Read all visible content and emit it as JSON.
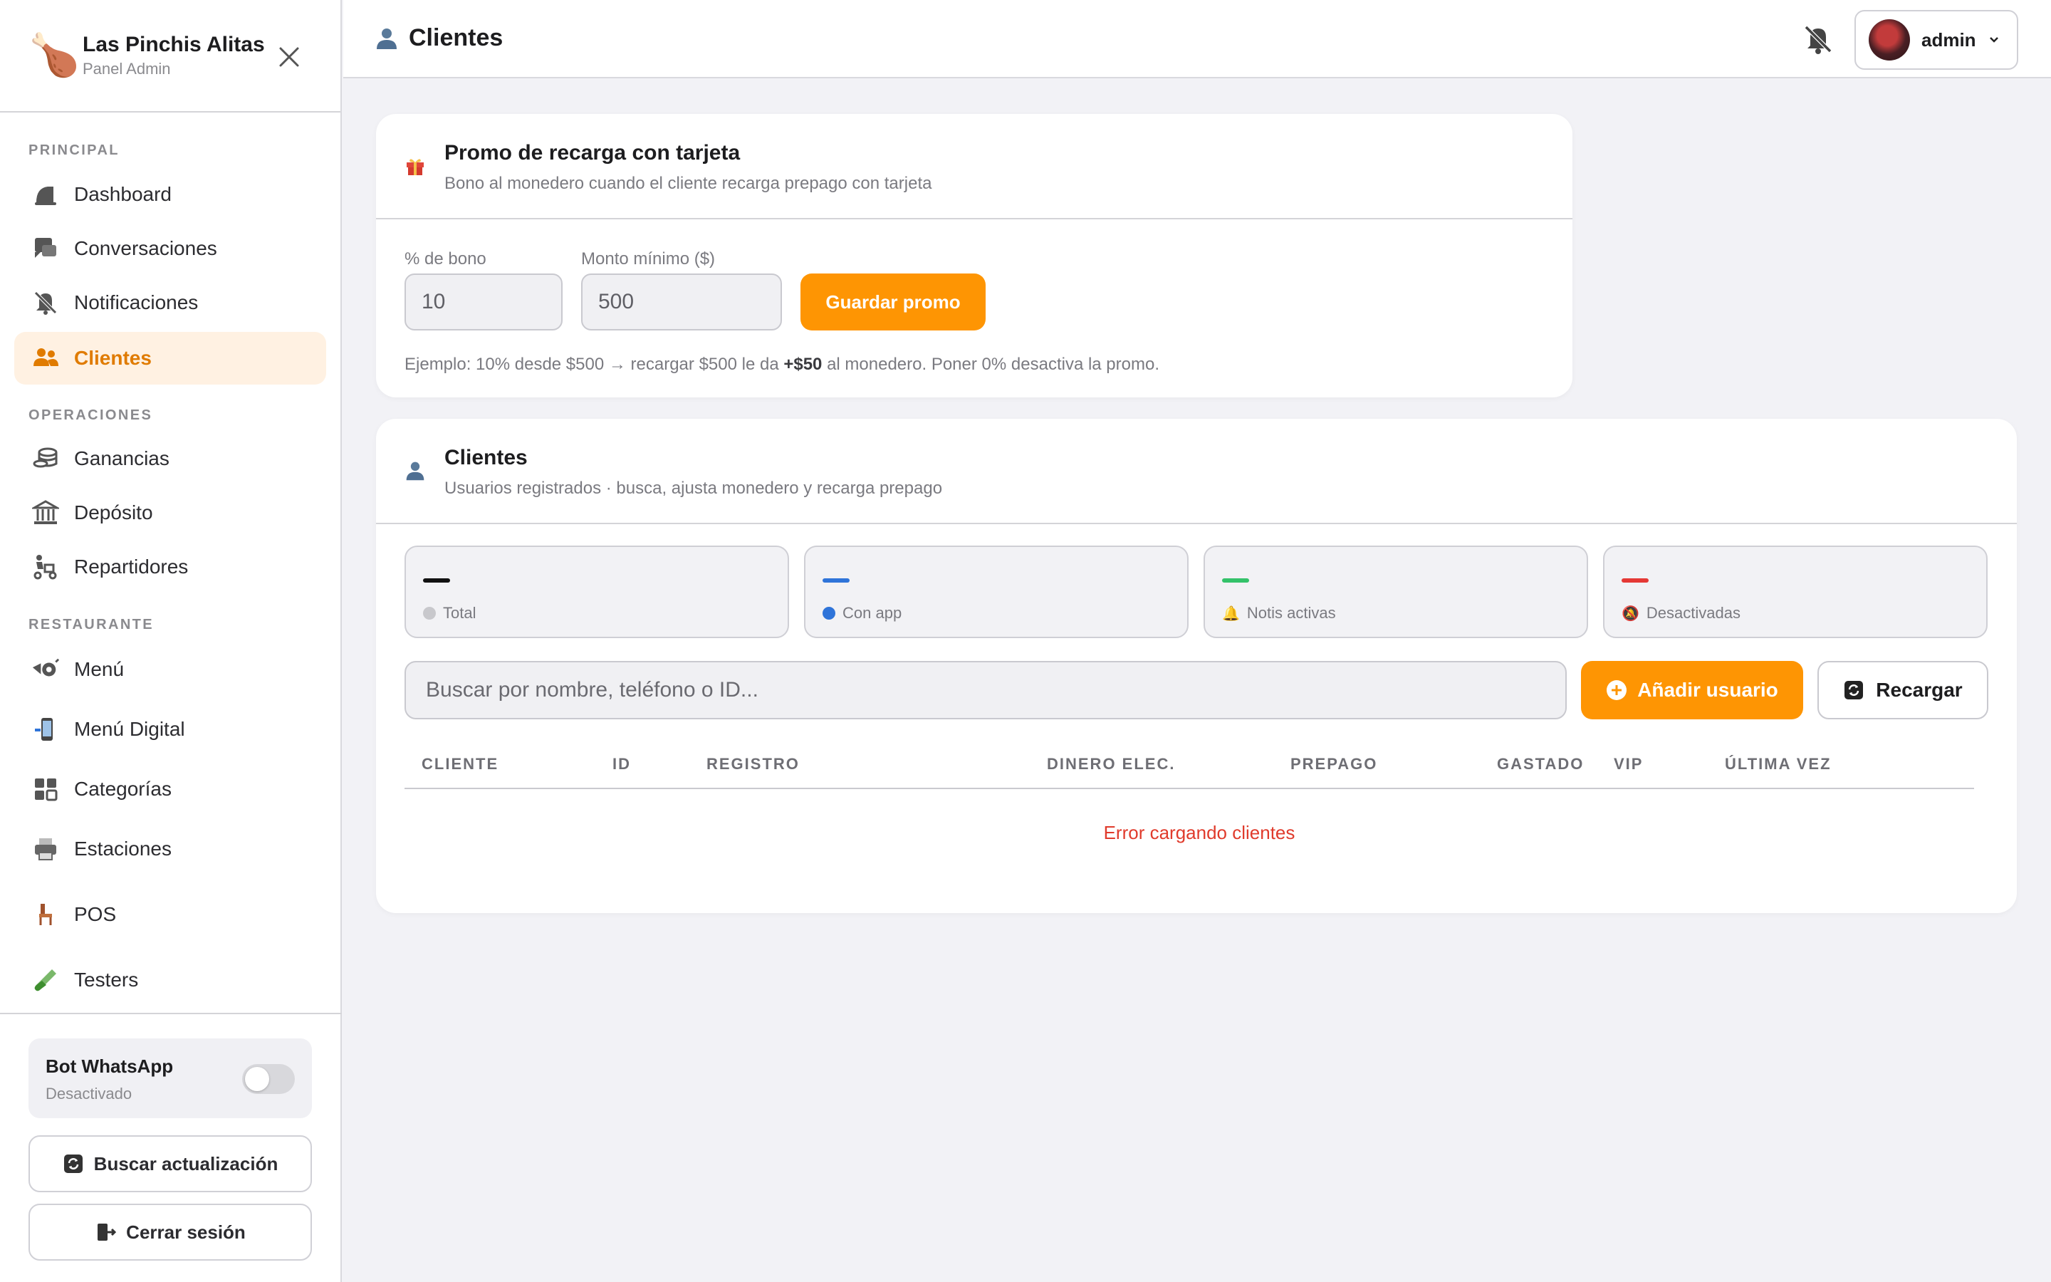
{
  "brand": {
    "emoji": "🍗",
    "title": "Las Pinchis Alitas",
    "subtitle": "Panel Admin"
  },
  "sidebar": {
    "sections": [
      "PRINCIPAL",
      "OPERACIONES",
      "RESTAURANTE"
    ],
    "items": [
      {
        "label": "Dashboard",
        "icon": "dashboard-icon"
      },
      {
        "label": "Conversaciones",
        "icon": "chat-icon"
      },
      {
        "label": "Notificaciones",
        "icon": "bell-off-icon"
      },
      {
        "label": "Clientes",
        "icon": "users-icon",
        "active": true
      },
      {
        "label": "Ganancias",
        "icon": "coins-icon"
      },
      {
        "label": "Depósito",
        "icon": "bank-icon"
      },
      {
        "label": "Repartidores",
        "icon": "delivery-icon"
      },
      {
        "label": "Menú",
        "icon": "menu-icon"
      },
      {
        "label": "Menú Digital",
        "icon": "phone-icon"
      },
      {
        "label": "Categorías",
        "icon": "grid-icon"
      },
      {
        "label": "Estaciones",
        "icon": "printer-icon"
      },
      {
        "label": "POS",
        "icon": "chair-icon"
      },
      {
        "label": "Testers",
        "icon": "test-tube-icon"
      }
    ],
    "bot": {
      "title": "Bot WhatsApp",
      "status": "Desactivado",
      "enabled": false
    },
    "update_label": "Buscar actualización",
    "logout_label": "Cerrar sesión"
  },
  "header": {
    "title": "Clientes",
    "user": "admin"
  },
  "promo": {
    "title": "Promo de recarga con tarjeta",
    "subtitle": "Bono al monedero cuando el cliente recarga prepago con tarjeta",
    "bonus_label": "% de bono",
    "bonus_value": "10",
    "min_label": "Monto mínimo ($)",
    "min_value": "500",
    "save_label": "Guardar promo",
    "hint_before": "Ejemplo: 10% desde $500 → recargar $500 le da ",
    "hint_bold": "+$50",
    "hint_after": " al monedero. Poner 0% desactiva la promo."
  },
  "clients": {
    "title": "Clientes",
    "subtitle": "Usuarios registrados · busca, ajusta monedero y recarga prepago",
    "stats": [
      {
        "label": "Total",
        "value": "—",
        "color": "#111111"
      },
      {
        "label": "Con app",
        "value": "—",
        "color": "#2f74d9"
      },
      {
        "label": "Notis activas",
        "value": "—",
        "color": "#34c26a"
      },
      {
        "label": "Desactivadas",
        "value": "—",
        "color": "#e53935"
      }
    ],
    "search_placeholder": "Buscar por nombre, teléfono o ID...",
    "add_label": "Añadir usuario",
    "reload_label": "Recargar",
    "columns": [
      "CLIENTE",
      "ID",
      "REGISTRO",
      "DINERO ELEC.",
      "PREPAGO",
      "GASTADO",
      "VIP",
      "ÚLTIMA VEZ"
    ],
    "error": "Error cargando clientes"
  },
  "colors": {
    "accent": "#fe9503",
    "active_bg": "#fff1e2",
    "active_text": "#e07b00",
    "error": "#e03b2c"
  }
}
